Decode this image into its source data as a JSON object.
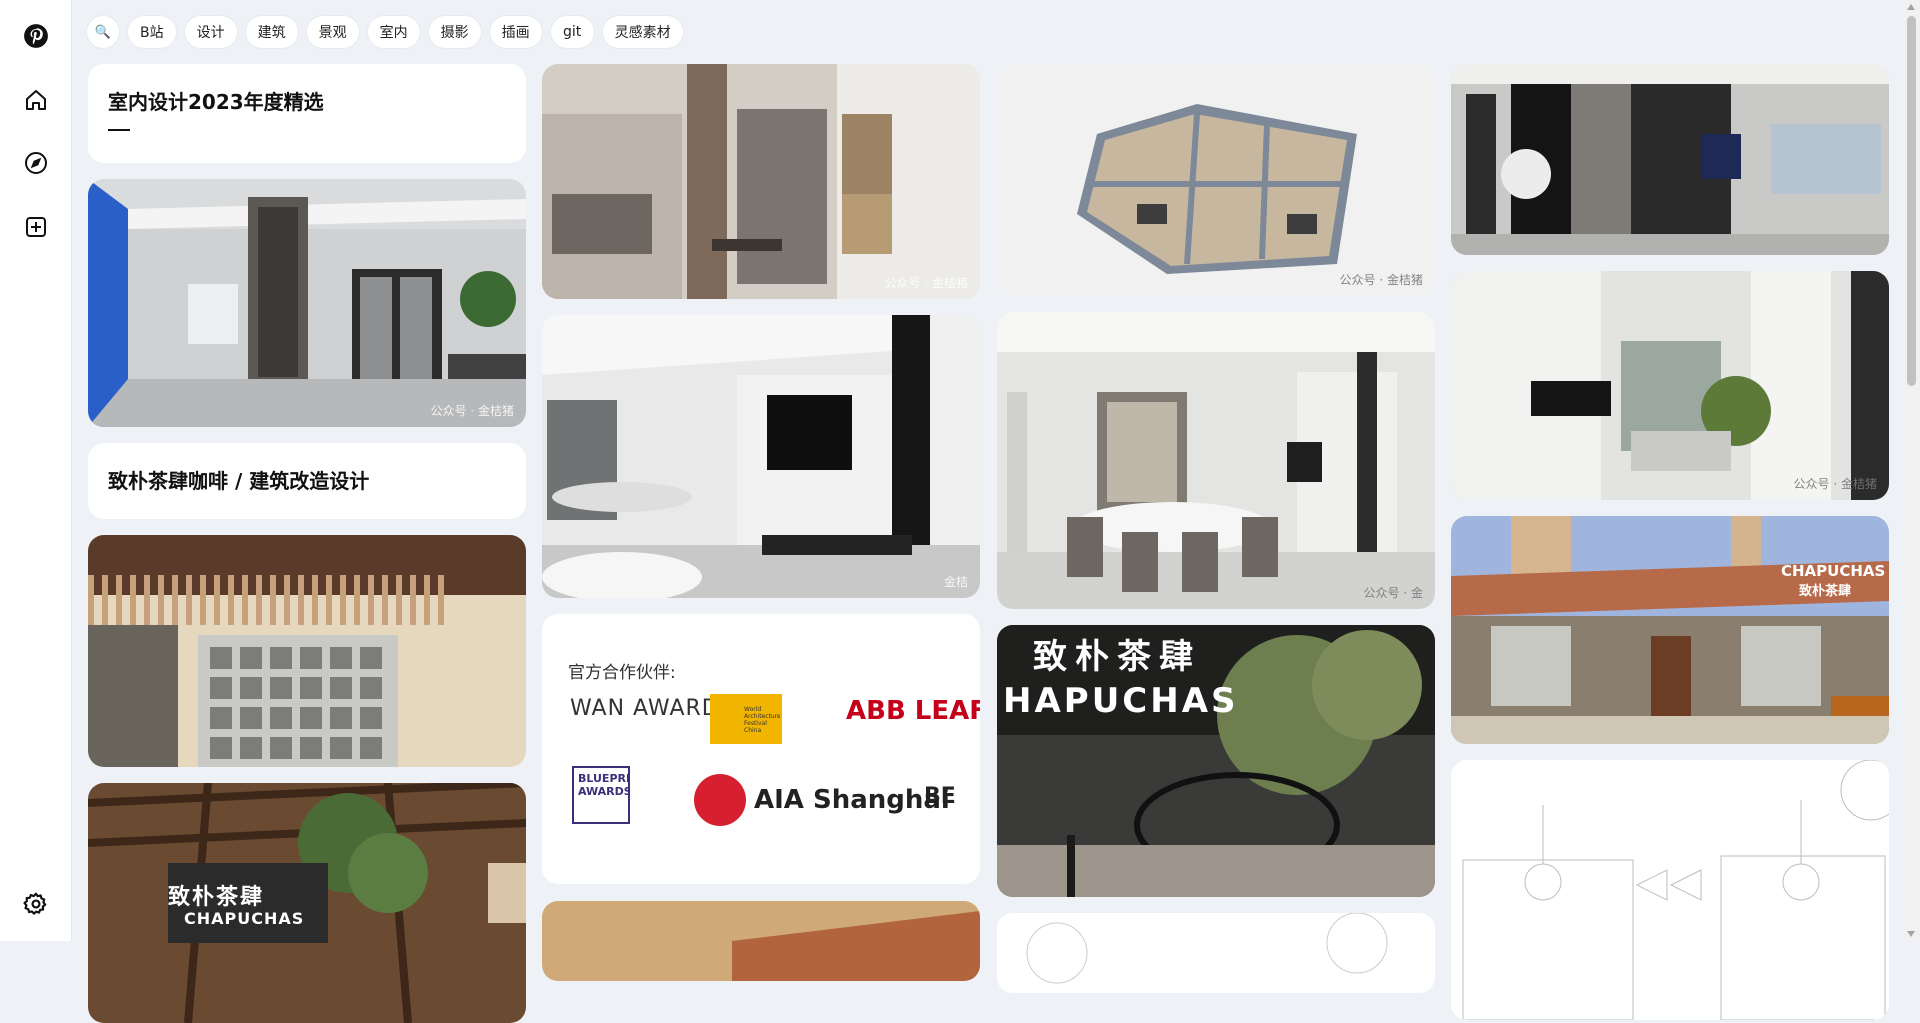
{
  "nav": {
    "icons": [
      "pinterest-logo-icon",
      "home-icon",
      "compass-icon",
      "add-icon",
      "gear-icon"
    ]
  },
  "filters": {
    "search_icon": "🔍",
    "chips": [
      "B站",
      "设计",
      "建筑",
      "景观",
      "室内",
      "摄影",
      "插画",
      "git",
      "灵感素材"
    ]
  },
  "columns": [
    {
      "cards": [
        {
          "kind": "text",
          "title": "室内设计2023年度精选"
        },
        {
          "kind": "image",
          "scene": "grey-living-room",
          "watermark": "公众号 · 金桔猪"
        },
        {
          "kind": "text",
          "title": "致朴茶肆咖啡 / 建筑改造设计"
        },
        {
          "kind": "image",
          "scene": "cafe-facade-brick",
          "watermark": ""
        },
        {
          "kind": "image",
          "scene": "cafe-interior-roof",
          "sign": "CHAPUCHAS",
          "sign_cn": "致朴茶肆"
        }
      ]
    },
    {
      "cards": [
        {
          "kind": "image",
          "scene": "entry-wood-wall",
          "watermark": "公众号 · 金桔猪"
        },
        {
          "kind": "image",
          "scene": "white-living-tv",
          "watermark": "金桔"
        },
        {
          "kind": "partners",
          "heading": "官方合作伙伴:",
          "logos": [
            "WAN AWARDS",
            "World Architecture Festival China",
            "ABB LEAF AWARDS",
            "BLUEPRINT AWARDS",
            "AIA Shanghai",
            "BE"
          ]
        },
        {
          "kind": "image",
          "scene": "roof-detail",
          "watermark": ""
        }
      ]
    },
    {
      "cards": [
        {
          "kind": "image",
          "scene": "floorplan-3d",
          "watermark": "公众号 · 金桔猪"
        },
        {
          "kind": "image",
          "scene": "dining-room",
          "watermark": "公众号 · 金"
        },
        {
          "kind": "image",
          "scene": "courtyard-tree",
          "sign": "HAPUCHAS",
          "sign_cn": "致朴茶肆"
        },
        {
          "kind": "image",
          "scene": "sketch",
          "watermark": ""
        }
      ]
    },
    {
      "cards": [
        {
          "kind": "image",
          "scene": "dark-marble-living",
          "watermark": ""
        },
        {
          "kind": "image",
          "scene": "white-cabinet-living",
          "watermark": "公众号 · 金桔猪"
        },
        {
          "kind": "image",
          "scene": "cafe-exterior",
          "sign": "CHAPUCHAS",
          "sign_cn": "致朴茶肆"
        },
        {
          "kind": "image",
          "scene": "elevation-drawing",
          "watermark": ""
        }
      ]
    }
  ],
  "colors": {
    "background": "#eef1f6",
    "brand": "#e60023"
  }
}
